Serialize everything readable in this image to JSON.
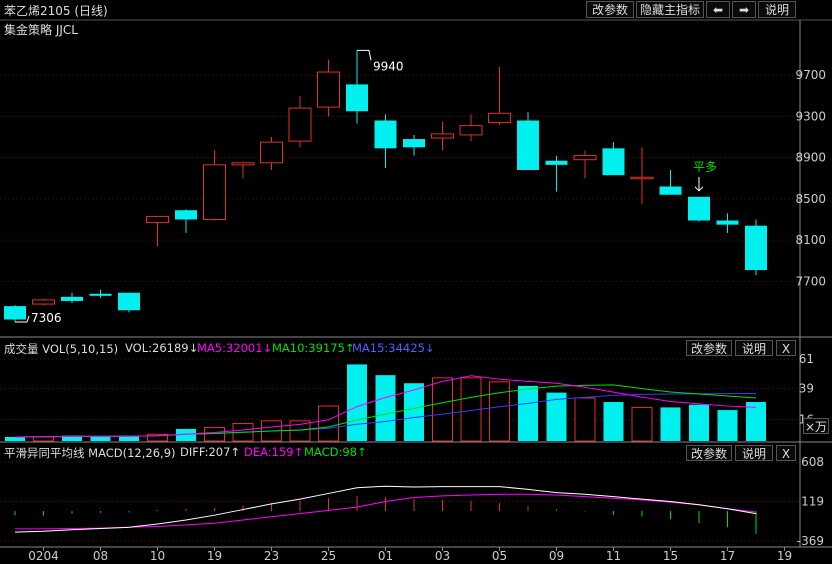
{
  "header": {
    "title": "苯乙烯2105 (日线)",
    "strategy": "集金策略 JJCL",
    "buttons": {
      "change_params": "改参数",
      "hide_main": "隐藏主指标",
      "left": "⬅",
      "right": "➡",
      "help": "说明"
    }
  },
  "colors": {
    "up": "#e0302a",
    "down": "#00f0f0",
    "grid": "#6a0000",
    "axis_text": "#cccccc",
    "signal": "#00e000",
    "ma5": "#ff00ff",
    "ma10": "#00e000",
    "ma15": "#3a3aff"
  },
  "chart_data": [
    {
      "type": "candlestick",
      "title": "苯乙烯2105 (日线)",
      "y_ticks": [
        9700,
        9300,
        8900,
        8500,
        8100,
        7700
      ],
      "ylim": [
        7180,
        10060
      ],
      "max_label": "9940",
      "min_label": "7306",
      "signal": {
        "label": "平多",
        "index": 24
      },
      "candles": [
        {
          "o": 7460,
          "h": 7470,
          "l": 7306,
          "c": 7330
        },
        {
          "o": 7480,
          "h": 7530,
          "l": 7470,
          "c": 7520
        },
        {
          "o": 7550,
          "h": 7590,
          "l": 7490,
          "c": 7510
        },
        {
          "o": 7580,
          "h": 7620,
          "l": 7540,
          "c": 7560
        },
        {
          "o": 7590,
          "h": 7590,
          "l": 7400,
          "c": 7420
        },
        {
          "o": 8270,
          "h": 8330,
          "l": 8040,
          "c": 8330
        },
        {
          "o": 8390,
          "h": 8400,
          "l": 8170,
          "c": 8300
        },
        {
          "o": 8300,
          "h": 8970,
          "l": 8290,
          "c": 8830
        },
        {
          "o": 8830,
          "h": 8860,
          "l": 8700,
          "c": 8850
        },
        {
          "o": 8850,
          "h": 9100,
          "l": 8780,
          "c": 9050
        },
        {
          "o": 9060,
          "h": 9500,
          "l": 9000,
          "c": 9380
        },
        {
          "o": 9390,
          "h": 9850,
          "l": 9300,
          "c": 9730
        },
        {
          "o": 9610,
          "h": 9940,
          "l": 9230,
          "c": 9350
        },
        {
          "o": 9260,
          "h": 9320,
          "l": 8800,
          "c": 8990
        },
        {
          "o": 9080,
          "h": 9120,
          "l": 8920,
          "c": 9000
        },
        {
          "o": 9090,
          "h": 9250,
          "l": 8970,
          "c": 9130
        },
        {
          "o": 9120,
          "h": 9320,
          "l": 9060,
          "c": 9210
        },
        {
          "o": 9240,
          "h": 9780,
          "l": 9220,
          "c": 9330
        },
        {
          "o": 9260,
          "h": 9340,
          "l": 8780,
          "c": 8780
        },
        {
          "o": 8870,
          "h": 8920,
          "l": 8570,
          "c": 8830
        },
        {
          "o": 8880,
          "h": 8970,
          "l": 8700,
          "c": 8920
        },
        {
          "o": 8990,
          "h": 9050,
          "l": 8750,
          "c": 8730
        },
        {
          "o": 8710,
          "h": 9000,
          "l": 8450,
          "c": 8710
        },
        {
          "o": 8620,
          "h": 8780,
          "l": 8560,
          "c": 8540
        },
        {
          "o": 8520,
          "h": 8520,
          "l": 8280,
          "c": 8290
        },
        {
          "o": 8290,
          "h": 8360,
          "l": 8170,
          "c": 8250
        },
        {
          "o": 8240,
          "h": 8300,
          "l": 7760,
          "c": 7810
        }
      ],
      "x_labels": [
        {
          "i": 1,
          "label": "0204"
        },
        {
          "i": 3,
          "label": "08"
        },
        {
          "i": 5,
          "label": "10"
        },
        {
          "i": 7,
          "label": "19"
        },
        {
          "i": 9,
          "label": "23"
        },
        {
          "i": 11,
          "label": "25"
        },
        {
          "i": 13,
          "label": "01"
        },
        {
          "i": 15,
          "label": "03"
        },
        {
          "i": 17,
          "label": "05"
        },
        {
          "i": 19,
          "label": "09"
        },
        {
          "i": 21,
          "label": "11"
        },
        {
          "i": 23,
          "label": "15"
        },
        {
          "i": 25,
          "label": "17"
        },
        {
          "i": 27,
          "label": "19"
        }
      ]
    },
    {
      "type": "bar",
      "title": "成交量 VOL(5,10,15)",
      "vol_text": "VOL:26189↓",
      "ma5_text": "MA5:32001↓",
      "ma10_text": "MA10:39175↑",
      "ma15_text": "MA15:34425↓",
      "y_ticks": [
        61,
        39,
        16
      ],
      "ylim": [
        0,
        64
      ],
      "unit": "×万",
      "values": [
        3,
        3,
        4,
        3.5,
        4,
        5,
        9,
        10,
        13,
        15,
        15,
        26,
        57,
        49,
        43,
        47,
        47,
        44,
        41,
        36,
        32,
        29,
        25,
        25,
        27,
        23,
        29
      ],
      "ma5": [
        3,
        3.2,
        3.4,
        3.5,
        3.5,
        3.9,
        5.1,
        6.3,
        8.2,
        10.4,
        12.4,
        15.8,
        25.6,
        32.4,
        38,
        44.4,
        48.6,
        46,
        44.4,
        43,
        40,
        36.4,
        32.6,
        29.4,
        27.6,
        26,
        25
      ],
      "ma10": [
        3,
        3.2,
        3.4,
        3.5,
        3.5,
        3.9,
        5,
        5.6,
        6.5,
        7.4,
        8.2,
        10.4,
        15.6,
        20,
        24.3,
        28.5,
        32.5,
        35.9,
        38.7,
        40.8,
        41.4,
        41.8,
        39,
        36.5,
        35,
        33.5,
        32
      ],
      "ma15": [
        3,
        3.2,
        3.4,
        3.5,
        3.5,
        3.9,
        5,
        5.6,
        6.5,
        7.4,
        8,
        9.5,
        12.5,
        14.5,
        17.5,
        20,
        22.7,
        25.5,
        28,
        31,
        32.5,
        34,
        34.7,
        35,
        35.2,
        35.3,
        35.4
      ]
    },
    {
      "type": "line",
      "title": "平滑异同平均线 MACD(12,26,9)",
      "diff_text": "DIFF:207↑",
      "dea_text": "DEA:159↑",
      "macd_text": "MACD:98↑",
      "y_ticks": [
        608,
        119,
        -369
      ],
      "ylim": [
        -420,
        660
      ],
      "diff": [
        -260,
        -250,
        -230,
        -215,
        -200,
        -160,
        -110,
        -50,
        20,
        90,
        150,
        220,
        290,
        310,
        300,
        305,
        305,
        305,
        270,
        230,
        210,
        180,
        150,
        120,
        80,
        30,
        -30
      ],
      "dea": [
        -220,
        -220,
        -215,
        -210,
        -200,
        -190,
        -170,
        -150,
        -110,
        -70,
        -30,
        10,
        50,
        120,
        170,
        190,
        200,
        210,
        210,
        200,
        180,
        160,
        140,
        110,
        80,
        30,
        -10
      ],
      "macd": [
        -50,
        -55,
        -30,
        -20,
        -15,
        15,
        30,
        40,
        70,
        100,
        130,
        160,
        190,
        175,
        150,
        140,
        130,
        100,
        65,
        25,
        -5,
        -45,
        -65,
        -100,
        -150,
        -200,
        -280
      ]
    }
  ],
  "panels": {
    "volume": {
      "params": "改参数",
      "help": "说明",
      "close": "X"
    },
    "macd": {
      "params": "改参数",
      "help": "说明",
      "close": "X"
    }
  }
}
